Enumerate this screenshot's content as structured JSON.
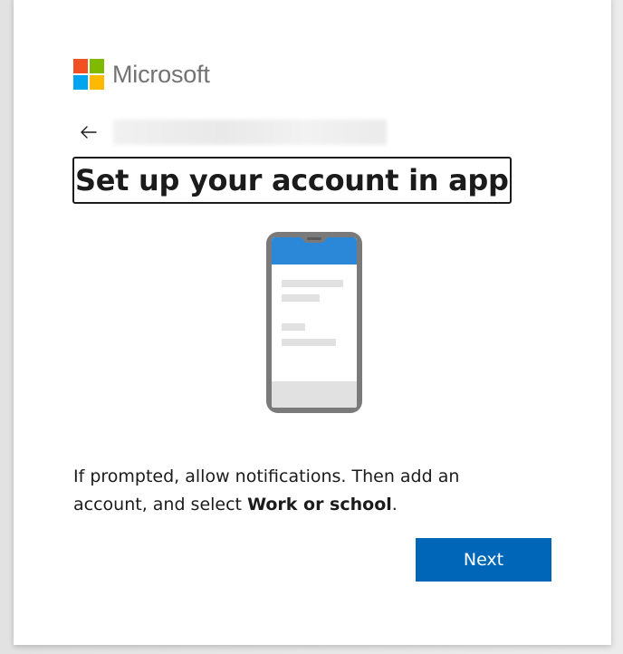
{
  "brand": {
    "name": "Microsoft",
    "colors": [
      "#f25022",
      "#7fba00",
      "#00a4ef",
      "#ffb900"
    ]
  },
  "header": {
    "back_icon": "arrow-left-icon"
  },
  "main": {
    "title": "Set up your account in app",
    "instruction_prefix": "If prompted, allow notifications. Then add an account, and select ",
    "instruction_bold": "Work or school",
    "instruction_suffix": "."
  },
  "actions": {
    "next_label": "Next",
    "accent_color": "#0067b8"
  }
}
